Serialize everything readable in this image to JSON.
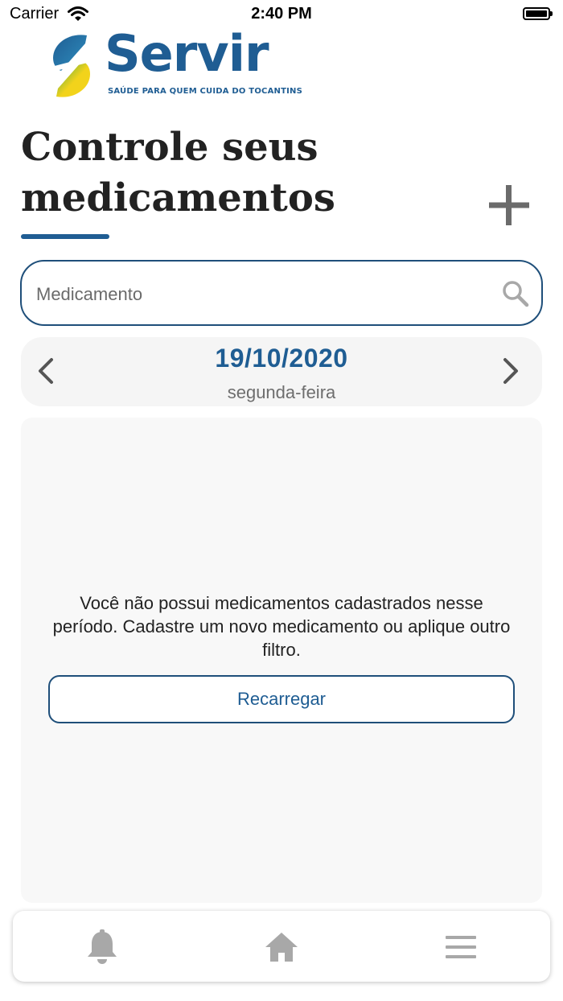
{
  "status_bar": {
    "carrier": "Carrier",
    "time": "2:40 PM"
  },
  "logo": {
    "wordmark": "Servir",
    "tagline": "SAÚDE PARA QUEM CUIDA DO TOCANTINS"
  },
  "page": {
    "title": "Controle seus medicamentos",
    "add_icon": "plus-icon"
  },
  "search": {
    "placeholder": "Medicamento",
    "value": "",
    "icon": "search-icon"
  },
  "date_nav": {
    "date": "19/10/2020",
    "weekday": "segunda-feira",
    "prev_icon": "chevron-left-icon",
    "next_icon": "chevron-right-icon"
  },
  "content": {
    "empty_message": "Você não possui medicamentos cadastrados nesse período. Cadastre um novo medicamento ou aplique outro filtro.",
    "reload_label": "Recarregar"
  },
  "tab_bar": {
    "items": [
      {
        "icon": "bell-icon"
      },
      {
        "icon": "home-icon"
      },
      {
        "icon": "menu-icon"
      }
    ]
  },
  "colors": {
    "brand_blue": "#1f5d93",
    "border_blue": "#1f4f7a",
    "logo_yellow": "#f2d31b",
    "logo_green": "#3aa24b",
    "icon_gray": "#a8a8a8"
  }
}
